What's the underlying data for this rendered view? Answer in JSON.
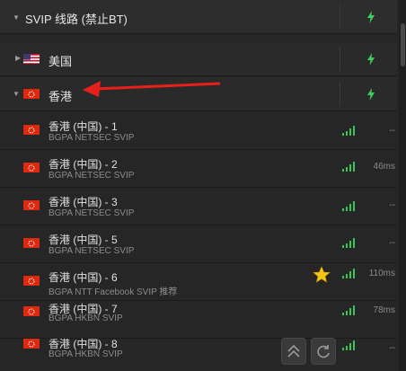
{
  "groups": {
    "svip": {
      "label": "SVIP 线路 (禁止BT)"
    },
    "us": {
      "label": "美国"
    },
    "hk": {
      "label": "香港"
    }
  },
  "servers": [
    {
      "name": "香港 (中国) - 1",
      "sub": "BGPA NETSEC SVIP",
      "latency": "--"
    },
    {
      "name": "香港 (中国) - 2",
      "sub": "BGPA NETSEC SVIP",
      "latency": "46ms"
    },
    {
      "name": "香港 (中国) - 3",
      "sub": "BGPA NETSEC SVIP",
      "latency": "--"
    },
    {
      "name": "香港 (中国) - 5",
      "sub": "BGPA NETSEC SVIP",
      "latency": "--"
    },
    {
      "name": "香港 (中国) - 6",
      "sub": "BGPA NTT Facebook SVIP 推荐",
      "latency": "110ms",
      "recommended": true
    },
    {
      "name": "香港 (中国) - 7",
      "sub": "BGPA HKBN SVIP",
      "latency": "78ms"
    },
    {
      "name": "香港 (中国) - 8",
      "sub": "BGPA HKBN SVIP",
      "latency": "--"
    }
  ],
  "colors": {
    "signal": "#39c45a",
    "bolt": "#3ecf5b",
    "star": "#f5c518",
    "annotation_arrow": "#e8201c"
  },
  "icons": [
    "chevron-down-icon",
    "chevron-right-icon",
    "lightning-icon",
    "flag-us-icon",
    "flag-hk-icon",
    "signal-icon",
    "star-icon",
    "scroll-top-icon",
    "refresh-icon"
  ]
}
